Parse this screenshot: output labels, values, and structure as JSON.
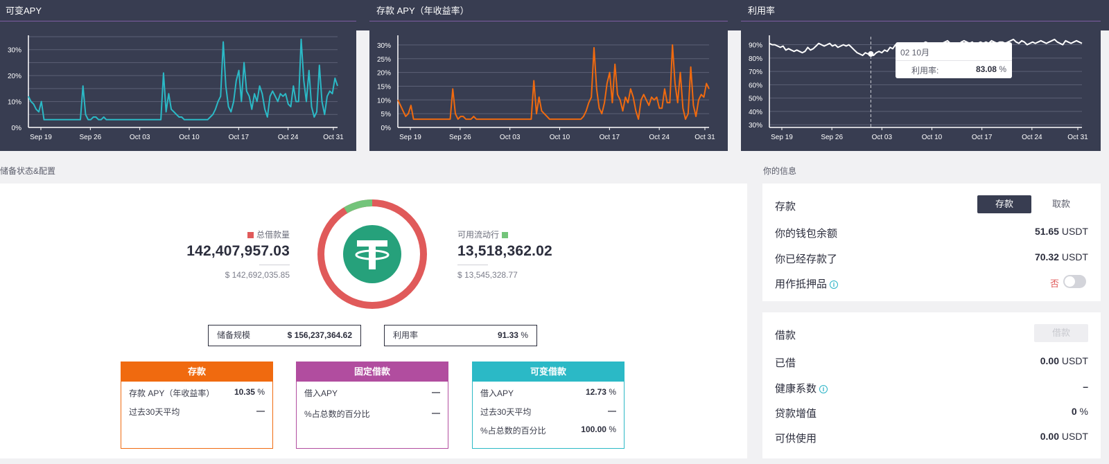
{
  "panels": {
    "variable_apy": {
      "title": "可变APY"
    },
    "deposit_apy": {
      "title": "存款 APY（年收益率）"
    },
    "utilization": {
      "title": "利用率"
    }
  },
  "tooltip": {
    "date": "02 10月",
    "label": "利用率:",
    "value": "83.08",
    "unit": "%"
  },
  "reserve_section_title": "储备状态&配置",
  "your_info_title": "你的信息",
  "reserve": {
    "total_borrowed_label": "总借款量",
    "total_borrowed": "142,407,957.03",
    "total_borrowed_usd": "$ 142,692,035.85",
    "available_label": "可用流动行",
    "available": "13,518,362.02",
    "available_usd": "$ 13,545,328.77",
    "reserve_size_label": "储备规模",
    "reserve_size": "$ 156,237,364.62",
    "utilization_label": "利用率",
    "utilization_value": "91.33",
    "utilization_unit": "%",
    "borrowed_color": "#e05a5a",
    "available_color": "#73c47a",
    "token_icon": "tether-icon"
  },
  "cards": {
    "deposit": {
      "title": "存款",
      "color": "#f06a0f",
      "rows": [
        {
          "label": "存款 APY（年收益率）",
          "value": "10.35",
          "unit": "%"
        },
        {
          "label": "过去30天平均",
          "value": "—",
          "unit": ""
        }
      ]
    },
    "stable": {
      "title": "固定借款",
      "color": "#b14d9f",
      "rows": [
        {
          "label": "借入APY",
          "value": "—",
          "unit": ""
        },
        {
          "label": "%占总数的百分比",
          "value": "—",
          "unit": ""
        }
      ]
    },
    "variable": {
      "title": "可变借款",
      "color": "#2bb9c6",
      "rows": [
        {
          "label": "借入APY",
          "value": "12.73",
          "unit": "%"
        },
        {
          "label": "过去30天平均",
          "value": "—",
          "unit": ""
        },
        {
          "label": "%占总数的百分比",
          "value": "100.00",
          "unit": "%"
        }
      ]
    }
  },
  "deposit_info": {
    "title": "存款",
    "deposit_btn": "存款",
    "withdraw_btn": "取款",
    "wallet_label": "你的钱包余额",
    "wallet_value": "51.65",
    "deposited_label": "你已经存款了",
    "deposited_value": "70.32",
    "collateral_label": "用作抵押品",
    "collateral_value": "否",
    "unit": "USDT"
  },
  "borrow_info": {
    "title": "借款",
    "borrow_btn": "借款",
    "borrowed_label": "已借",
    "borrowed_value": "0.00",
    "health_label": "健康系数",
    "health_value": "–",
    "ltv_label": "贷款增值",
    "ltv_value": "0",
    "ltv_unit": "%",
    "available_label": "可供使用",
    "available_value": "0.00",
    "unit": "USDT"
  },
  "chart_data": [
    {
      "type": "line",
      "title": "可变APY",
      "color": "#2bb9c6",
      "x_ticks": [
        "Sep 19",
        "Sep 26",
        "Oct 03",
        "Oct 10",
        "Oct 17",
        "Oct 24",
        "Oct 31"
      ],
      "y_ticks": [
        "0%",
        "10%",
        "20%",
        "30%"
      ],
      "ylim": [
        0,
        35
      ],
      "series": [
        {
          "values": [
            12,
            10,
            9,
            7,
            6,
            10,
            3,
            3,
            3,
            3,
            3,
            3,
            3,
            3,
            3,
            3,
            3,
            3,
            3,
            3,
            3,
            16,
            5,
            3,
            3,
            4,
            4,
            3,
            3,
            4,
            3,
            3,
            3,
            3,
            3,
            3,
            3,
            3,
            3,
            3,
            3,
            3,
            3,
            3,
            3,
            3,
            3,
            3,
            3,
            3,
            3,
            3,
            21,
            6,
            13,
            7,
            6,
            5,
            4,
            4,
            3,
            3,
            3,
            3,
            3,
            3,
            3,
            3,
            3,
            3,
            4,
            5,
            7,
            10,
            12,
            33,
            16,
            8,
            6,
            10,
            18,
            22,
            10,
            25,
            14,
            12,
            7,
            13,
            10,
            16,
            13,
            7,
            4,
            12,
            14,
            12,
            10,
            13,
            12,
            13,
            9,
            8,
            16,
            10,
            10,
            34,
            18,
            10,
            22,
            8,
            4,
            6,
            24,
            10,
            5,
            12,
            14,
            13,
            19,
            16
          ]
        }
      ]
    },
    {
      "type": "line",
      "title": "存款 APY（年收益率）",
      "color": "#f06a0f",
      "x_ticks": [
        "Sep 19",
        "Sep 26",
        "Oct 03",
        "Oct 10",
        "Oct 17",
        "Oct 24",
        "Oct 31"
      ],
      "y_ticks": [
        "0%",
        "5%",
        "10%",
        "15%",
        "20%",
        "25%",
        "30%"
      ],
      "ylim": [
        0,
        33
      ],
      "series": [
        {
          "values": [
            10,
            8,
            6,
            4,
            5,
            8,
            3,
            3,
            3,
            3,
            3,
            3,
            3,
            3,
            3,
            3,
            3,
            3,
            3,
            3,
            3,
            14,
            5,
            3,
            4,
            4,
            3,
            3,
            3,
            4,
            3,
            3,
            3,
            3,
            3,
            3,
            3,
            3,
            3,
            3,
            3,
            3,
            3,
            3,
            3,
            3,
            3,
            3,
            3,
            3,
            3,
            3,
            17,
            5,
            11,
            6,
            5,
            4,
            3,
            3,
            3,
            3,
            3,
            3,
            3,
            3,
            3,
            3,
            3,
            3,
            3,
            4,
            6,
            9,
            11,
            29,
            14,
            7,
            5,
            9,
            16,
            20,
            9,
            23,
            12,
            10,
            6,
            11,
            9,
            14,
            11,
            6,
            3,
            10,
            12,
            10,
            8,
            11,
            10,
            11,
            7,
            7,
            14,
            9,
            9,
            30,
            16,
            9,
            20,
            7,
            3,
            5,
            22,
            8,
            4,
            10,
            12,
            11,
            16,
            14
          ]
        }
      ]
    },
    {
      "type": "line",
      "title": "利用率",
      "color": "#ffffff",
      "x_ticks": [
        "Sep 19",
        "Sep 26",
        "Oct 03",
        "Oct 10",
        "Oct 17",
        "Oct 24",
        "Oct 31"
      ],
      "y_ticks": [
        "30%",
        "40%",
        "50%",
        "60%",
        "70%",
        "80%",
        "90%"
      ],
      "ylim": [
        28,
        96
      ],
      "series": [
        {
          "values": [
            91,
            90,
            90,
            89,
            88,
            89,
            86,
            87,
            86,
            85,
            86,
            85,
            84,
            85,
            88,
            86,
            87,
            89,
            91,
            90,
            89,
            90,
            91,
            89,
            90,
            88,
            89,
            90,
            89,
            90,
            88,
            86,
            84,
            83,
            82,
            84,
            83,
            83.08,
            82,
            84,
            85,
            84,
            86,
            85,
            88,
            87,
            90,
            89,
            90,
            91,
            90,
            89,
            91,
            90,
            89,
            90,
            91,
            92,
            91,
            90,
            89,
            91,
            90,
            91,
            92,
            93,
            91,
            90,
            91,
            90,
            92,
            93,
            92,
            91,
            92,
            90,
            91,
            92,
            91,
            92,
            91,
            93,
            92,
            91,
            92,
            92,
            91,
            92,
            93,
            94,
            92,
            91,
            93,
            92,
            90,
            91,
            92,
            91,
            92,
            93,
            92,
            91,
            92,
            93,
            94,
            92,
            91,
            90,
            93,
            92,
            91,
            92,
            93,
            92,
            91
          ]
        }
      ]
    }
  ]
}
